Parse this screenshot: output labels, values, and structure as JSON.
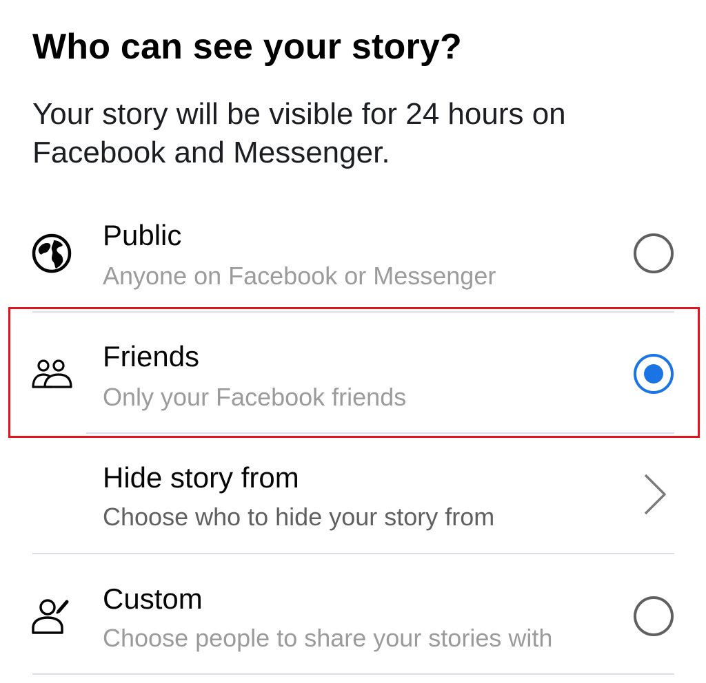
{
  "header": {
    "title": "Who can see your story?",
    "description": "Your story will be visible for 24 hours on Facebook and Messenger."
  },
  "options": [
    {
      "title": "Public",
      "subtitle": "Anyone on Facebook or Messenger",
      "icon": "globe-icon",
      "control": "radio",
      "selected": false
    },
    {
      "title": "Friends",
      "subtitle": "Only your Facebook friends",
      "icon": "friends-icon",
      "control": "radio",
      "selected": true
    },
    {
      "title": "Hide story from",
      "subtitle": "Choose who to hide your story from",
      "icon": null,
      "control": "chevron-right-icon",
      "selected": false
    },
    {
      "title": "Custom",
      "subtitle": "Choose people to share your stories with",
      "icon": "custom-person-edit-icon",
      "control": "radio",
      "selected": false
    }
  ],
  "colors": {
    "accent": "#1b74e4",
    "highlight_border": "#e0161e",
    "subtitle_text": "#9b9b9b",
    "divider": "#dadde1"
  }
}
